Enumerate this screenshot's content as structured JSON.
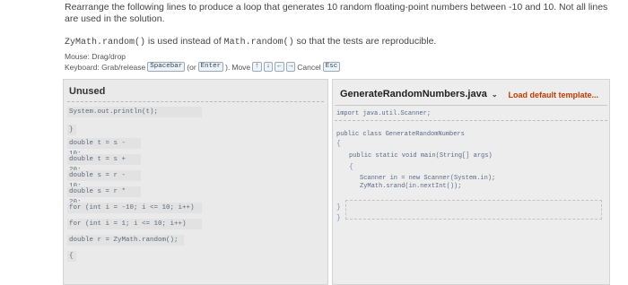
{
  "instructions": {
    "line1": "Rearrange the following lines to produce a loop that generates 10 random floating-point numbers between -10 and 10. Not all lines are used in the solution.",
    "line2_pre": "ZyMath.random()",
    "line2_mid": " is used instead of ",
    "line2_code2": "Math.random()",
    "line2_post": " so that the tests are reproducible."
  },
  "hints": {
    "mouse": "Mouse: Drag/drop",
    "keyboard_label": "Keyboard: Grab/release",
    "key_spacebar": "Spacebar",
    "or": "(or",
    "key_enter": "Enter",
    "close_paren": ").",
    "move": "Move",
    "key_up": "↑",
    "key_down": "↓",
    "key_left": "←",
    "key_right": "→",
    "cancel": "Cancel",
    "key_esc": "Esc"
  },
  "unused": {
    "title": "Unused",
    "blocks": [
      "System.out.println(t);",
      "}",
      "double t = s - 10;",
      "double t = s + 20;",
      "double s = r - 10;",
      "double s = r * 20;",
      "for (int i = -10; i <= 10; i++)",
      "for (int i = 1; i <= 10; i++)",
      "double r = ZyMath.random();",
      "{"
    ]
  },
  "editor": {
    "file_name": "GenerateRandomNumbers.java",
    "load_default": "Load default template...",
    "import_line": "import java.util.Scanner;",
    "class_line": "public class GenerateRandomNumbers",
    "open_brace": "{",
    "main_line": "public static void main(String[] args)",
    "scanner_line": "Scanner in = new Scanner(System.in);",
    "srand_line": "ZyMath.srand(in.nextInt());",
    "close_brace": "}"
  }
}
